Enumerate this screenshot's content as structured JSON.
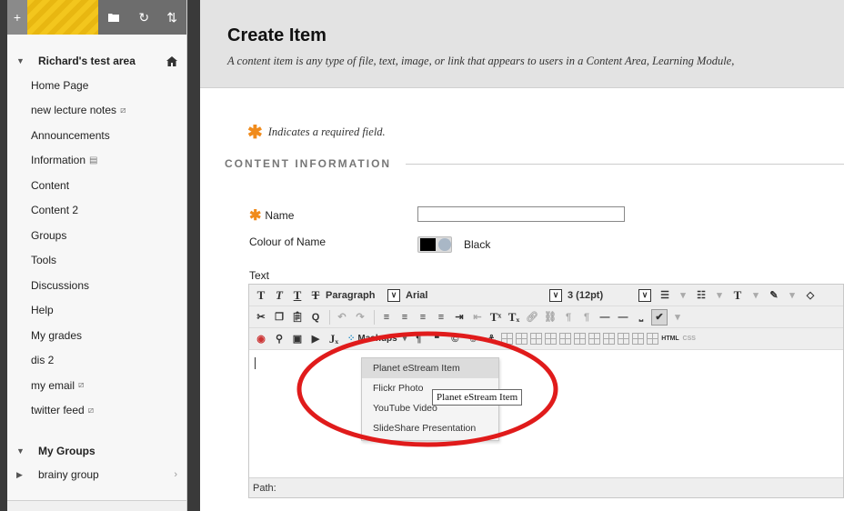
{
  "sidebar": {
    "toolbar": {
      "add_icon": "+",
      "folder_icon": "folder-icon",
      "refresh_icon": "↻",
      "sort_icon": "⇅"
    },
    "course": {
      "title": "Richard's test area",
      "home_icon": "home-icon"
    },
    "menu_items": [
      {
        "label": "Home Page",
        "mini": ""
      },
      {
        "label": "new lecture notes",
        "mini": "⧄"
      },
      {
        "label": "Announcements",
        "mini": ""
      },
      {
        "label": "Information",
        "mini": "▤"
      },
      {
        "label": "Content",
        "mini": ""
      },
      {
        "label": "Content 2",
        "mini": ""
      },
      {
        "label": "Groups",
        "mini": ""
      },
      {
        "label": "Tools",
        "mini": ""
      },
      {
        "label": "Discussions",
        "mini": ""
      },
      {
        "label": "Help",
        "mini": ""
      },
      {
        "label": "My grades",
        "mini": ""
      },
      {
        "label": "dis 2",
        "mini": ""
      },
      {
        "label": "my email",
        "mini": "⧄"
      },
      {
        "label": "twitter feed",
        "mini": "⧄"
      }
    ],
    "groups": {
      "title": "My Groups",
      "items": [
        {
          "label": "brainy group",
          "arrow": "›"
        }
      ]
    }
  },
  "page": {
    "title": "Create Item",
    "description": "A content item is any type of file, text, image, or link that appears to users in a Content Area, Learning Module,",
    "required_note": "Indicates a required field.",
    "required_star": "✱",
    "section_heading": "CONTENT INFORMATION"
  },
  "form": {
    "name_label": "Name",
    "name_value": "",
    "colour_label": "Colour of Name",
    "colour_value": "Black",
    "colour_hex": "#000000",
    "text_label": "Text"
  },
  "editor": {
    "paragraph_select": "Paragraph",
    "font_select": "Arial",
    "size_select": "3 (12pt)",
    "mashups_label": "Mashups",
    "path_label": "Path:",
    "html_label": "HTML",
    "css_label": "CSS",
    "mashups_menu": [
      "Planet eStream Item",
      "Flickr Photo",
      "YouTube Video",
      "SlideShare Presentation"
    ],
    "tooltip": "Planet eStream Item"
  },
  "colors": {
    "highlight_ring": "#e01b1b",
    "required_star": "#f08b1c",
    "sidebar_stripe": "#f3c61d"
  }
}
